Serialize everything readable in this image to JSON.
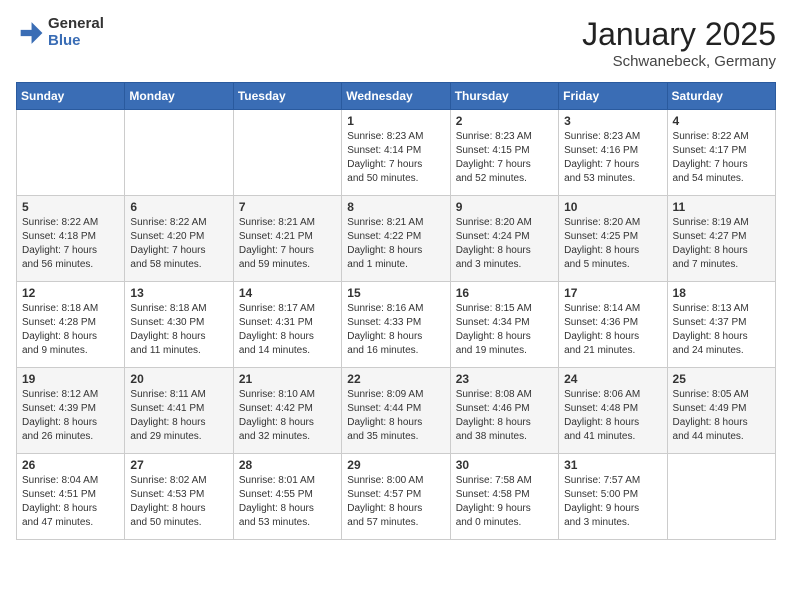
{
  "header": {
    "logo_general": "General",
    "logo_blue": "Blue",
    "title": "January 2025",
    "subtitle": "Schwanebeck, Germany"
  },
  "weekdays": [
    "Sunday",
    "Monday",
    "Tuesday",
    "Wednesday",
    "Thursday",
    "Friday",
    "Saturday"
  ],
  "weeks": [
    [
      {
        "day": "",
        "info": ""
      },
      {
        "day": "",
        "info": ""
      },
      {
        "day": "",
        "info": ""
      },
      {
        "day": "1",
        "info": "Sunrise: 8:23 AM\nSunset: 4:14 PM\nDaylight: 7 hours\nand 50 minutes."
      },
      {
        "day": "2",
        "info": "Sunrise: 8:23 AM\nSunset: 4:15 PM\nDaylight: 7 hours\nand 52 minutes."
      },
      {
        "day": "3",
        "info": "Sunrise: 8:23 AM\nSunset: 4:16 PM\nDaylight: 7 hours\nand 53 minutes."
      },
      {
        "day": "4",
        "info": "Sunrise: 8:22 AM\nSunset: 4:17 PM\nDaylight: 7 hours\nand 54 minutes."
      }
    ],
    [
      {
        "day": "5",
        "info": "Sunrise: 8:22 AM\nSunset: 4:18 PM\nDaylight: 7 hours\nand 56 minutes."
      },
      {
        "day": "6",
        "info": "Sunrise: 8:22 AM\nSunset: 4:20 PM\nDaylight: 7 hours\nand 58 minutes."
      },
      {
        "day": "7",
        "info": "Sunrise: 8:21 AM\nSunset: 4:21 PM\nDaylight: 7 hours\nand 59 minutes."
      },
      {
        "day": "8",
        "info": "Sunrise: 8:21 AM\nSunset: 4:22 PM\nDaylight: 8 hours\nand 1 minute."
      },
      {
        "day": "9",
        "info": "Sunrise: 8:20 AM\nSunset: 4:24 PM\nDaylight: 8 hours\nand 3 minutes."
      },
      {
        "day": "10",
        "info": "Sunrise: 8:20 AM\nSunset: 4:25 PM\nDaylight: 8 hours\nand 5 minutes."
      },
      {
        "day": "11",
        "info": "Sunrise: 8:19 AM\nSunset: 4:27 PM\nDaylight: 8 hours\nand 7 minutes."
      }
    ],
    [
      {
        "day": "12",
        "info": "Sunrise: 8:18 AM\nSunset: 4:28 PM\nDaylight: 8 hours\nand 9 minutes."
      },
      {
        "day": "13",
        "info": "Sunrise: 8:18 AM\nSunset: 4:30 PM\nDaylight: 8 hours\nand 11 minutes."
      },
      {
        "day": "14",
        "info": "Sunrise: 8:17 AM\nSunset: 4:31 PM\nDaylight: 8 hours\nand 14 minutes."
      },
      {
        "day": "15",
        "info": "Sunrise: 8:16 AM\nSunset: 4:33 PM\nDaylight: 8 hours\nand 16 minutes."
      },
      {
        "day": "16",
        "info": "Sunrise: 8:15 AM\nSunset: 4:34 PM\nDaylight: 8 hours\nand 19 minutes."
      },
      {
        "day": "17",
        "info": "Sunrise: 8:14 AM\nSunset: 4:36 PM\nDaylight: 8 hours\nand 21 minutes."
      },
      {
        "day": "18",
        "info": "Sunrise: 8:13 AM\nSunset: 4:37 PM\nDaylight: 8 hours\nand 24 minutes."
      }
    ],
    [
      {
        "day": "19",
        "info": "Sunrise: 8:12 AM\nSunset: 4:39 PM\nDaylight: 8 hours\nand 26 minutes."
      },
      {
        "day": "20",
        "info": "Sunrise: 8:11 AM\nSunset: 4:41 PM\nDaylight: 8 hours\nand 29 minutes."
      },
      {
        "day": "21",
        "info": "Sunrise: 8:10 AM\nSunset: 4:42 PM\nDaylight: 8 hours\nand 32 minutes."
      },
      {
        "day": "22",
        "info": "Sunrise: 8:09 AM\nSunset: 4:44 PM\nDaylight: 8 hours\nand 35 minutes."
      },
      {
        "day": "23",
        "info": "Sunrise: 8:08 AM\nSunset: 4:46 PM\nDaylight: 8 hours\nand 38 minutes."
      },
      {
        "day": "24",
        "info": "Sunrise: 8:06 AM\nSunset: 4:48 PM\nDaylight: 8 hours\nand 41 minutes."
      },
      {
        "day": "25",
        "info": "Sunrise: 8:05 AM\nSunset: 4:49 PM\nDaylight: 8 hours\nand 44 minutes."
      }
    ],
    [
      {
        "day": "26",
        "info": "Sunrise: 8:04 AM\nSunset: 4:51 PM\nDaylight: 8 hours\nand 47 minutes."
      },
      {
        "day": "27",
        "info": "Sunrise: 8:02 AM\nSunset: 4:53 PM\nDaylight: 8 hours\nand 50 minutes."
      },
      {
        "day": "28",
        "info": "Sunrise: 8:01 AM\nSunset: 4:55 PM\nDaylight: 8 hours\nand 53 minutes."
      },
      {
        "day": "29",
        "info": "Sunrise: 8:00 AM\nSunset: 4:57 PM\nDaylight: 8 hours\nand 57 minutes."
      },
      {
        "day": "30",
        "info": "Sunrise: 7:58 AM\nSunset: 4:58 PM\nDaylight: 9 hours\nand 0 minutes."
      },
      {
        "day": "31",
        "info": "Sunrise: 7:57 AM\nSunset: 5:00 PM\nDaylight: 9 hours\nand 3 minutes."
      },
      {
        "day": "",
        "info": ""
      }
    ]
  ]
}
